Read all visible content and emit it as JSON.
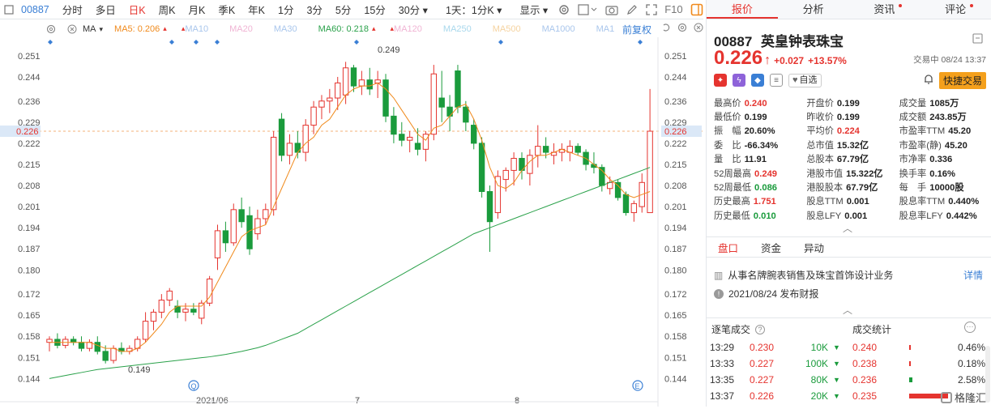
{
  "toolbar": {
    "code": "00887",
    "items": [
      "分时",
      "多日",
      "日K",
      "周K",
      "月K",
      "季K",
      "年K",
      "1分",
      "3分",
      "5分",
      "15分",
      "30分",
      "1天：1分K",
      "显示"
    ],
    "active": "日K",
    "fq_label": "F10"
  },
  "ma_row": {
    "ma_label": "MA",
    "items": [
      {
        "label": "MA5: 0.206",
        "color": "#f08a1c",
        "arrow": "up"
      },
      {
        "label": "MA10",
        "color": "#a9c6ec"
      },
      {
        "label": "MA20",
        "color": "#f0b4d4"
      },
      {
        "label": "MA30",
        "color": "#a9c6ec"
      },
      {
        "label": "MA60: 0.218",
        "color": "#2aa14a",
        "arrow": "up"
      },
      {
        "label": "MA120",
        "color": "#f0b4d4"
      },
      {
        "label": "MA250",
        "color": "#a9d8ec"
      },
      {
        "label": "MA500",
        "color": "#f5d3a0"
      },
      {
        "label": "MA1000",
        "color": "#a9c6ec"
      },
      {
        "label": "MA1",
        "color": "#a9c6ec"
      }
    ],
    "adjust_label": "前复权"
  },
  "chart_data": {
    "type": "candlestick",
    "ylim": [
      0.139,
      0.255
    ],
    "y_ticks": [
      "0.251",
      "0.244",
      "0.236",
      "0.229",
      "0.222",
      "0.215",
      "0.208",
      "0.201",
      "0.194",
      "0.187",
      "0.180",
      "0.172",
      "0.165",
      "0.158",
      "0.151",
      "0.144"
    ],
    "current_price_label": "0.226",
    "current_price": 0.226,
    "x_labels": [
      "2021/06",
      "7",
      "8"
    ],
    "annotations": [
      {
        "text": "0.249",
        "kind": "high"
      },
      {
        "text": "0.149",
        "kind": "low"
      }
    ],
    "candles": [
      {
        "o": 0.156,
        "h": 0.158,
        "l": 0.153,
        "c": 0.157
      },
      {
        "o": 0.157,
        "h": 0.159,
        "l": 0.154,
        "c": 0.155
      },
      {
        "o": 0.155,
        "h": 0.158,
        "l": 0.154,
        "c": 0.157
      },
      {
        "o": 0.157,
        "h": 0.158,
        "l": 0.155,
        "c": 0.156
      },
      {
        "o": 0.156,
        "h": 0.158,
        "l": 0.153,
        "c": 0.154
      },
      {
        "o": 0.154,
        "h": 0.157,
        "l": 0.153,
        "c": 0.156
      },
      {
        "o": 0.156,
        "h": 0.158,
        "l": 0.152,
        "c": 0.153
      },
      {
        "o": 0.153,
        "h": 0.155,
        "l": 0.149,
        "c": 0.15
      },
      {
        "o": 0.15,
        "h": 0.155,
        "l": 0.149,
        "c": 0.154
      },
      {
        "o": 0.154,
        "h": 0.156,
        "l": 0.152,
        "c": 0.153
      },
      {
        "o": 0.153,
        "h": 0.155,
        "l": 0.152,
        "c": 0.154
      },
      {
        "o": 0.154,
        "h": 0.158,
        "l": 0.153,
        "c": 0.157
      },
      {
        "o": 0.157,
        "h": 0.166,
        "l": 0.156,
        "c": 0.163
      },
      {
        "o": 0.163,
        "h": 0.167,
        "l": 0.16,
        "c": 0.166
      },
      {
        "o": 0.166,
        "h": 0.172,
        "l": 0.164,
        "c": 0.17
      },
      {
        "o": 0.17,
        "h": 0.174,
        "l": 0.168,
        "c": 0.173
      },
      {
        "o": 0.168,
        "h": 0.17,
        "l": 0.164,
        "c": 0.166
      },
      {
        "o": 0.166,
        "h": 0.169,
        "l": 0.163,
        "c": 0.167
      },
      {
        "o": 0.167,
        "h": 0.169,
        "l": 0.165,
        "c": 0.166
      },
      {
        "o": 0.164,
        "h": 0.17,
        "l": 0.162,
        "c": 0.169
      },
      {
        "o": 0.169,
        "h": 0.178,
        "l": 0.168,
        "c": 0.177
      },
      {
        "o": 0.184,
        "h": 0.195,
        "l": 0.18,
        "c": 0.193
      },
      {
        "o": 0.193,
        "h": 0.196,
        "l": 0.186,
        "c": 0.189
      },
      {
        "o": 0.189,
        "h": 0.202,
        "l": 0.188,
        "c": 0.2
      },
      {
        "o": 0.2,
        "h": 0.204,
        "l": 0.194,
        "c": 0.196
      },
      {
        "o": 0.198,
        "h": 0.201,
        "l": 0.185,
        "c": 0.187
      },
      {
        "o": 0.192,
        "h": 0.2,
        "l": 0.19,
        "c": 0.197
      },
      {
        "o": 0.197,
        "h": 0.202,
        "l": 0.195,
        "c": 0.2
      },
      {
        "o": 0.2,
        "h": 0.226,
        "l": 0.198,
        "c": 0.224
      },
      {
        "o": 0.23,
        "h": 0.232,
        "l": 0.216,
        "c": 0.218
      },
      {
        "o": 0.218,
        "h": 0.225,
        "l": 0.215,
        "c": 0.222
      },
      {
        "o": 0.222,
        "h": 0.226,
        "l": 0.217,
        "c": 0.219
      },
      {
        "o": 0.219,
        "h": 0.23,
        "l": 0.216,
        "c": 0.228
      },
      {
        "o": 0.228,
        "h": 0.236,
        "l": 0.225,
        "c": 0.234
      },
      {
        "o": 0.234,
        "h": 0.238,
        "l": 0.23,
        "c": 0.236
      },
      {
        "o": 0.236,
        "h": 0.24,
        "l": 0.232,
        "c": 0.237
      },
      {
        "o": 0.237,
        "h": 0.244,
        "l": 0.233,
        "c": 0.242
      },
      {
        "o": 0.238,
        "h": 0.249,
        "l": 0.235,
        "c": 0.247
      },
      {
        "o": 0.247,
        "h": 0.248,
        "l": 0.239,
        "c": 0.241
      },
      {
        "o": 0.241,
        "h": 0.246,
        "l": 0.238,
        "c": 0.243
      },
      {
        "o": 0.243,
        "h": 0.247,
        "l": 0.238,
        "c": 0.24
      },
      {
        "o": 0.242,
        "h": 0.246,
        "l": 0.237,
        "c": 0.243
      },
      {
        "o": 0.243,
        "h": 0.245,
        "l": 0.229,
        "c": 0.231
      },
      {
        "o": 0.231,
        "h": 0.234,
        "l": 0.222,
        "c": 0.225
      },
      {
        "o": 0.225,
        "h": 0.229,
        "l": 0.221,
        "c": 0.223
      },
      {
        "o": 0.223,
        "h": 0.226,
        "l": 0.219,
        "c": 0.224
      },
      {
        "o": 0.222,
        "h": 0.227,
        "l": 0.218,
        "c": 0.22
      },
      {
        "o": 0.22,
        "h": 0.226,
        "l": 0.216,
        "c": 0.225
      },
      {
        "o": 0.225,
        "h": 0.248,
        "l": 0.223,
        "c": 0.245
      },
      {
        "o": 0.237,
        "h": 0.246,
        "l": 0.229,
        "c": 0.234
      },
      {
        "o": 0.234,
        "h": 0.238,
        "l": 0.226,
        "c": 0.231
      },
      {
        "o": 0.246,
        "h": 0.248,
        "l": 0.232,
        "c": 0.234
      },
      {
        "o": 0.234,
        "h": 0.236,
        "l": 0.226,
        "c": 0.229
      },
      {
        "o": 0.228,
        "h": 0.23,
        "l": 0.22,
        "c": 0.222
      },
      {
        "o": 0.222,
        "h": 0.224,
        "l": 0.204,
        "c": 0.206
      },
      {
        "o": 0.206,
        "h": 0.208,
        "l": 0.186,
        "c": 0.196
      },
      {
        "o": 0.199,
        "h": 0.213,
        "l": 0.197,
        "c": 0.211
      },
      {
        "o": 0.21,
        "h": 0.214,
        "l": 0.206,
        "c": 0.213
      },
      {
        "o": 0.213,
        "h": 0.219,
        "l": 0.208,
        "c": 0.217
      },
      {
        "o": 0.217,
        "h": 0.219,
        "l": 0.21,
        "c": 0.213
      },
      {
        "o": 0.212,
        "h": 0.22,
        "l": 0.208,
        "c": 0.218
      },
      {
        "o": 0.218,
        "h": 0.228,
        "l": 0.214,
        "c": 0.221
      },
      {
        "o": 0.221,
        "h": 0.224,
        "l": 0.217,
        "c": 0.219
      },
      {
        "o": 0.218,
        "h": 0.222,
        "l": 0.215,
        "c": 0.219
      },
      {
        "o": 0.219,
        "h": 0.222,
        "l": 0.216,
        "c": 0.22
      },
      {
        "o": 0.219,
        "h": 0.223,
        "l": 0.216,
        "c": 0.221
      },
      {
        "o": 0.221,
        "h": 0.222,
        "l": 0.218,
        "c": 0.219
      },
      {
        "o": 0.219,
        "h": 0.22,
        "l": 0.213,
        "c": 0.215
      },
      {
        "o": 0.215,
        "h": 0.219,
        "l": 0.212,
        "c": 0.214
      },
      {
        "o": 0.214,
        "h": 0.215,
        "l": 0.206,
        "c": 0.208
      },
      {
        "o": 0.207,
        "h": 0.211,
        "l": 0.205,
        "c": 0.209
      },
      {
        "o": 0.209,
        "h": 0.21,
        "l": 0.203,
        "c": 0.204
      },
      {
        "o": 0.205,
        "h": 0.206,
        "l": 0.198,
        "c": 0.199
      },
      {
        "o": 0.199,
        "h": 0.203,
        "l": 0.196,
        "c": 0.202
      },
      {
        "o": 0.201,
        "h": 0.212,
        "l": 0.199,
        "c": 0.209
      },
      {
        "o": 0.199,
        "h": 0.24,
        "l": 0.199,
        "c": 0.226
      }
    ],
    "ma5": [
      0.156,
      0.156,
      0.156,
      0.156,
      0.156,
      0.156,
      0.155,
      0.154,
      0.154,
      0.153,
      0.153,
      0.154,
      0.156,
      0.159,
      0.162,
      0.166,
      0.168,
      0.168,
      0.168,
      0.168,
      0.171,
      0.176,
      0.181,
      0.186,
      0.191,
      0.193,
      0.194,
      0.195,
      0.201,
      0.207,
      0.213,
      0.219,
      0.222,
      0.224,
      0.228,
      0.23,
      0.234,
      0.238,
      0.24,
      0.241,
      0.241,
      0.242,
      0.24,
      0.237,
      0.233,
      0.229,
      0.225,
      0.223,
      0.227,
      0.228,
      0.231,
      0.234,
      0.235,
      0.23,
      0.223,
      0.214,
      0.208,
      0.207,
      0.209,
      0.213,
      0.216,
      0.218,
      0.218,
      0.219,
      0.22,
      0.219,
      0.218,
      0.217,
      0.215,
      0.213,
      0.21,
      0.208,
      0.205,
      0.204,
      0.205,
      0.206
    ],
    "ma60": [
      0.144,
      0.1445,
      0.145,
      0.1455,
      0.146,
      0.1465,
      0.147,
      0.1473,
      0.1476,
      0.1479,
      0.1482,
      0.1485,
      0.1488,
      0.1491,
      0.1494,
      0.1497,
      0.15,
      0.1503,
      0.1506,
      0.1509,
      0.1512,
      0.1516,
      0.152,
      0.1525,
      0.153,
      0.1536,
      0.1542,
      0.155,
      0.156,
      0.157,
      0.158,
      0.159,
      0.1605,
      0.162,
      0.1635,
      0.165,
      0.1665,
      0.168,
      0.1695,
      0.171,
      0.1725,
      0.174,
      0.1755,
      0.177,
      0.1785,
      0.18,
      0.1815,
      0.183,
      0.1845,
      0.186,
      0.1875,
      0.189,
      0.1905,
      0.192,
      0.193,
      0.194,
      0.195,
      0.196,
      0.197,
      0.198,
      0.199,
      0.2,
      0.201,
      0.202,
      0.203,
      0.204,
      0.205,
      0.206,
      0.207,
      0.208,
      0.209,
      0.21,
      0.211,
      0.212,
      0.213,
      0.214
    ]
  },
  "quote": {
    "code": "00887",
    "name": "英皇钟表珠宝",
    "price": "0.226",
    "change": "+0.027",
    "change_pct": "+13.57%",
    "time": "交易中 08/24 13:37",
    "fav_label": "自选",
    "fast_trade": "快捷交易"
  },
  "tabs": [
    {
      "label": "报价",
      "active": true,
      "dot": false
    },
    {
      "label": "分析",
      "active": false,
      "dot": false
    },
    {
      "label": "资讯",
      "active": false,
      "dot": true
    },
    {
      "label": "评论",
      "active": false,
      "dot": true
    }
  ],
  "stats": [
    [
      {
        "l": "最高价",
        "v": "0.240",
        "c": "red"
      },
      {
        "l": "开盘价",
        "v": "0.199",
        "c": ""
      },
      {
        "l": "成交量",
        "v": "1085万",
        "c": ""
      }
    ],
    [
      {
        "l": "最低价",
        "v": "0.199",
        "c": ""
      },
      {
        "l": "昨收价",
        "v": "0.199",
        "c": ""
      },
      {
        "l": "成交额",
        "v": "243.85万",
        "c": ""
      }
    ],
    [
      {
        "l": "振　幅",
        "v": "20.60%",
        "c": ""
      },
      {
        "l": "平均价",
        "v": "0.224",
        "c": "red"
      },
      {
        "l": "市盈率TTM",
        "v": "45.20",
        "c": ""
      }
    ],
    [
      {
        "l": "委　比",
        "v": "-66.34%",
        "c": ""
      },
      {
        "l": "总市值",
        "v": "15.32亿",
        "c": ""
      },
      {
        "l": "市盈率(静)",
        "v": "45.20",
        "c": ""
      }
    ],
    [
      {
        "l": "量　比",
        "v": "11.91",
        "c": ""
      },
      {
        "l": "总股本",
        "v": "67.79亿",
        "c": ""
      },
      {
        "l": "市净率",
        "v": "0.336",
        "c": ""
      }
    ],
    [
      {
        "l": "52周最高",
        "v": "0.249",
        "c": "red"
      },
      {
        "l": "港股市值",
        "v": "15.322亿",
        "c": ""
      },
      {
        "l": "换手率",
        "v": "0.16%",
        "c": ""
      }
    ],
    [
      {
        "l": "52周最低",
        "v": "0.086",
        "c": "green"
      },
      {
        "l": "港股股本",
        "v": "67.79亿",
        "c": ""
      },
      {
        "l": "每　手",
        "v": "10000股",
        "c": ""
      }
    ],
    [
      {
        "l": "历史最高",
        "v": "1.751",
        "c": "red"
      },
      {
        "l": "股息TTM",
        "v": "0.001",
        "c": ""
      },
      {
        "l": "股息率TTM",
        "v": "0.440%",
        "c": ""
      }
    ],
    [
      {
        "l": "历史最低",
        "v": "0.010",
        "c": "green"
      },
      {
        "l": "股息LFY",
        "v": "0.001",
        "c": ""
      },
      {
        "l": "股息率LFY",
        "v": "0.442%",
        "c": ""
      }
    ]
  ],
  "sub_tabs": [
    {
      "label": "盘口",
      "active": true
    },
    {
      "label": "资金",
      "active": false
    },
    {
      "label": "异动",
      "active": false
    }
  ],
  "info": {
    "business": "从事名牌腕表销售及珠宝首饰设计业务",
    "detail": "详情",
    "report": "2021/08/24  发布财报"
  },
  "ticks_title": "逐笔成交",
  "stats_title": "成交统计",
  "ticks": [
    {
      "time": "13:29",
      "price": "0.230",
      "vol": "10K",
      "dir": "down"
    },
    {
      "time": "13:33",
      "price": "0.227",
      "vol": "100K",
      "dir": "down"
    },
    {
      "time": "13:35",
      "price": "0.227",
      "vol": "80K",
      "dir": "down"
    },
    {
      "time": "13:37",
      "price": "0.226",
      "vol": "20K",
      "dir": "down"
    }
  ],
  "vol_stats": [
    {
      "price": "0.240",
      "pct": "0.46%",
      "share": 0.0046
    },
    {
      "price": "0.238",
      "pct": "0.18%",
      "share": 0.0018
    },
    {
      "price": "0.236",
      "pct": "2.58%",
      "share": 0.0258
    },
    {
      "price": "0.235",
      "pct": "",
      "share": 0.3
    }
  ],
  "colors": {
    "up": "#e5342f",
    "down": "#1a9b3c",
    "ma5": "#f08a1c",
    "ma60": "#2aa14a",
    "accent": "#e5342f",
    "link": "#3a7fd5"
  },
  "watermark": "格隆汇"
}
